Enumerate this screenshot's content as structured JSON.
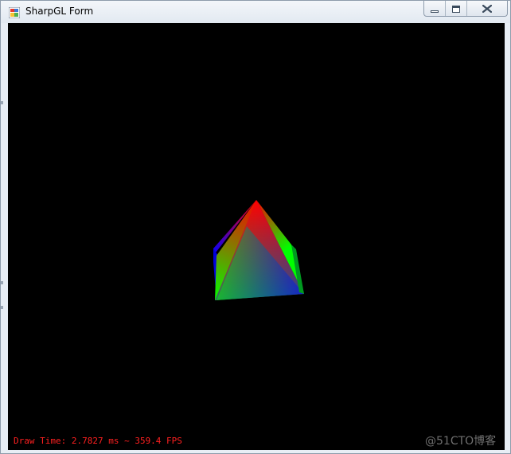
{
  "window": {
    "title": "SharpGL Form",
    "icons": {
      "app": "sharpgl-app-icon",
      "minimize": "minimize-icon",
      "maximize": "maximize-icon",
      "close": "close-icon"
    }
  },
  "viewport": {
    "background": "#000000",
    "status_text": "Draw Time: 2.7827 ms ~ 359.4 FPS",
    "status_color": "#ff2020",
    "object": "rgb-pyramid",
    "vertex_colors": [
      "#ff0000",
      "#00ff00",
      "#0000ff"
    ]
  },
  "watermark": "@51CTO博客"
}
